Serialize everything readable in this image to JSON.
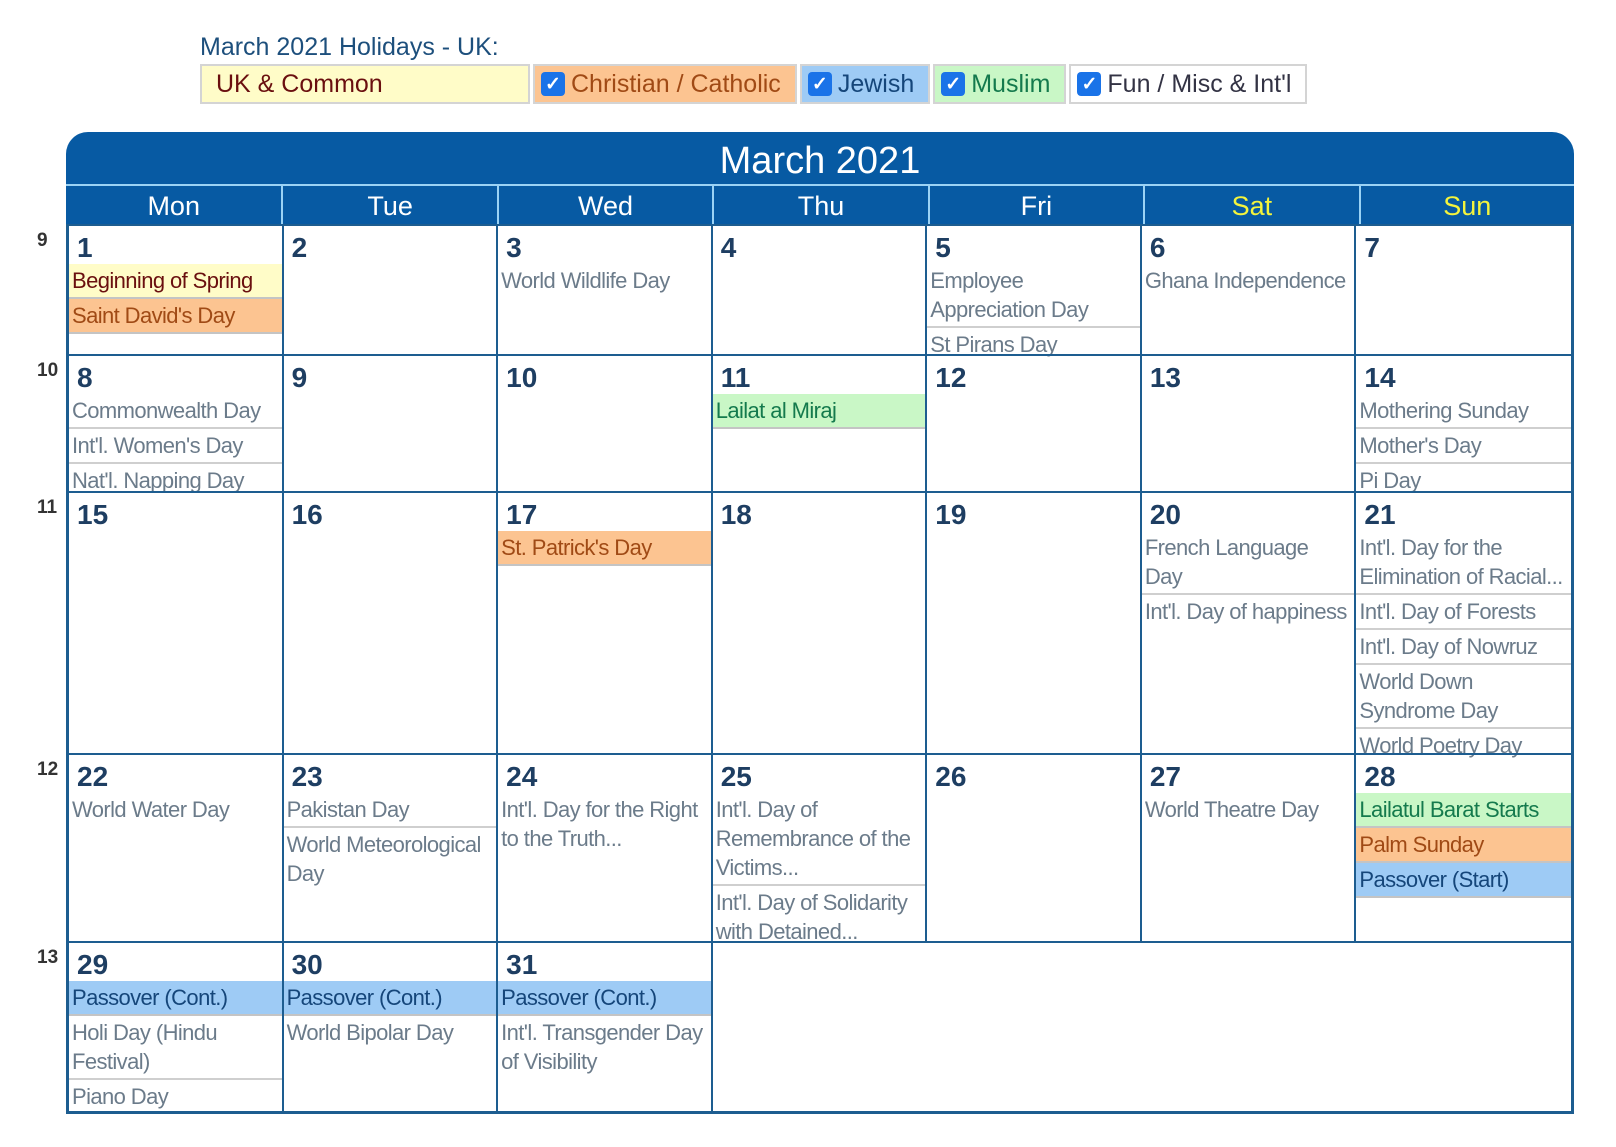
{
  "page": {
    "title": "March 2021 Holidays - UK:"
  },
  "filters": [
    {
      "label": "UK & Common",
      "category": "uk",
      "checkbox": false
    },
    {
      "label": "Christian / Catholic",
      "category": "christian",
      "checkbox": true,
      "checked": true
    },
    {
      "label": "Jewish",
      "category": "jewish",
      "checkbox": true,
      "checked": true
    },
    {
      "label": "Muslim",
      "category": "muslim",
      "checkbox": true,
      "checked": true
    },
    {
      "label": "Fun / Misc & Int'l",
      "category": "fun",
      "checkbox": true,
      "checked": true
    }
  ],
  "category_colors": {
    "uk": "#fffcc8",
    "christian": "#fcc491",
    "jewish": "#9ecbf5",
    "muslim": "#c9f7c6",
    "fun": "#ffffff",
    "header": "#075aa3",
    "weekend_label": "#f4f43c"
  },
  "calendar": {
    "title": "March 2021",
    "days_of_week": [
      {
        "label": "Mon",
        "weekend": false
      },
      {
        "label": "Tue",
        "weekend": false
      },
      {
        "label": "Wed",
        "weekend": false
      },
      {
        "label": "Thu",
        "weekend": false
      },
      {
        "label": "Fri",
        "weekend": false
      },
      {
        "label": "Sat",
        "weekend": true
      },
      {
        "label": "Sun",
        "weekend": true
      }
    ],
    "weeks": [
      {
        "week_number": "9",
        "days": [
          {
            "day": "1",
            "events": [
              {
                "name": "Beginning of Spring",
                "category": "uk"
              },
              {
                "name": "Saint David's Day",
                "category": "christian"
              }
            ]
          },
          {
            "day": "2",
            "events": []
          },
          {
            "day": "3",
            "events": [
              {
                "name": "World Wildlife Day",
                "category": "fun"
              }
            ]
          },
          {
            "day": "4",
            "events": []
          },
          {
            "day": "5",
            "events": [
              {
                "name": "Employee Appreciation Day",
                "category": "fun"
              },
              {
                "name": "St Pirans Day",
                "category": "fun"
              }
            ]
          },
          {
            "day": "6",
            "events": [
              {
                "name": "Ghana Independence",
                "category": "fun"
              }
            ]
          },
          {
            "day": "7",
            "events": []
          }
        ]
      },
      {
        "week_number": "10",
        "days": [
          {
            "day": "8",
            "events": [
              {
                "name": "Commonwealth Day",
                "category": "fun"
              },
              {
                "name": "Int'l. Women's Day",
                "category": "fun"
              },
              {
                "name": "Nat'l. Napping Day",
                "category": "fun"
              }
            ]
          },
          {
            "day": "9",
            "events": []
          },
          {
            "day": "10",
            "events": []
          },
          {
            "day": "11",
            "events": [
              {
                "name": "Lailat al Miraj",
                "category": "muslim"
              }
            ]
          },
          {
            "day": "12",
            "events": []
          },
          {
            "day": "13",
            "events": []
          },
          {
            "day": "14",
            "events": [
              {
                "name": "Mothering Sunday",
                "category": "fun"
              },
              {
                "name": "Mother's Day",
                "category": "fun"
              },
              {
                "name": "Pi Day",
                "category": "fun"
              }
            ]
          }
        ]
      },
      {
        "week_number": "11",
        "days": [
          {
            "day": "15",
            "events": []
          },
          {
            "day": "16",
            "events": []
          },
          {
            "day": "17",
            "events": [
              {
                "name": "St. Patrick's Day",
                "category": "christian"
              }
            ]
          },
          {
            "day": "18",
            "events": []
          },
          {
            "day": "19",
            "events": []
          },
          {
            "day": "20",
            "events": [
              {
                "name": "French Language Day",
                "category": "fun"
              },
              {
                "name": "Int'l. Day of happiness",
                "category": "fun"
              }
            ]
          },
          {
            "day": "21",
            "events": [
              {
                "name": "Int'l. Day for the Elimination of Racial...",
                "category": "fun"
              },
              {
                "name": "Int'l. Day of Forests",
                "category": "fun"
              },
              {
                "name": "Int'l. Day of Nowruz",
                "category": "fun"
              },
              {
                "name": "World Down Syndrome Day",
                "category": "fun"
              },
              {
                "name": "World Poetry Day",
                "category": "fun"
              }
            ]
          }
        ]
      },
      {
        "week_number": "12",
        "days": [
          {
            "day": "22",
            "events": [
              {
                "name": "World Water Day",
                "category": "fun"
              }
            ]
          },
          {
            "day": "23",
            "events": [
              {
                "name": "Pakistan Day",
                "category": "fun"
              },
              {
                "name": "World Meteorological Day",
                "category": "fun"
              }
            ]
          },
          {
            "day": "24",
            "events": [
              {
                "name": "Int'l. Day for the Right to the Truth...",
                "category": "fun"
              }
            ]
          },
          {
            "day": "25",
            "events": [
              {
                "name": "Int'l. Day of Remembrance of the Victims...",
                "category": "fun"
              },
              {
                "name": "Int'l. Day of Solidarity with Detained...",
                "category": "fun"
              }
            ]
          },
          {
            "day": "26",
            "events": []
          },
          {
            "day": "27",
            "events": [
              {
                "name": "World Theatre Day",
                "category": "fun"
              }
            ]
          },
          {
            "day": "28",
            "events": [
              {
                "name": "Lailatul Barat Starts",
                "category": "muslim"
              },
              {
                "name": "Palm Sunday",
                "category": "christian"
              },
              {
                "name": "Passover (Start)",
                "category": "jewish"
              }
            ]
          }
        ]
      },
      {
        "week_number": "13",
        "days": [
          {
            "day": "29",
            "events": [
              {
                "name": "Passover (Cont.)",
                "category": "jewish"
              },
              {
                "name": "Holi Day (Hindu Festival)",
                "category": "fun"
              },
              {
                "name": "Piano Day",
                "category": "fun"
              }
            ]
          },
          {
            "day": "30",
            "events": [
              {
                "name": "Passover (Cont.)",
                "category": "jewish"
              },
              {
                "name": "World Bipolar Day",
                "category": "fun"
              }
            ]
          },
          {
            "day": "31",
            "events": [
              {
                "name": "Passover (Cont.)",
                "category": "jewish"
              },
              {
                "name": "Int'l. Transgender Day of Visibility",
                "category": "fun"
              }
            ]
          }
        ]
      }
    ]
  }
}
